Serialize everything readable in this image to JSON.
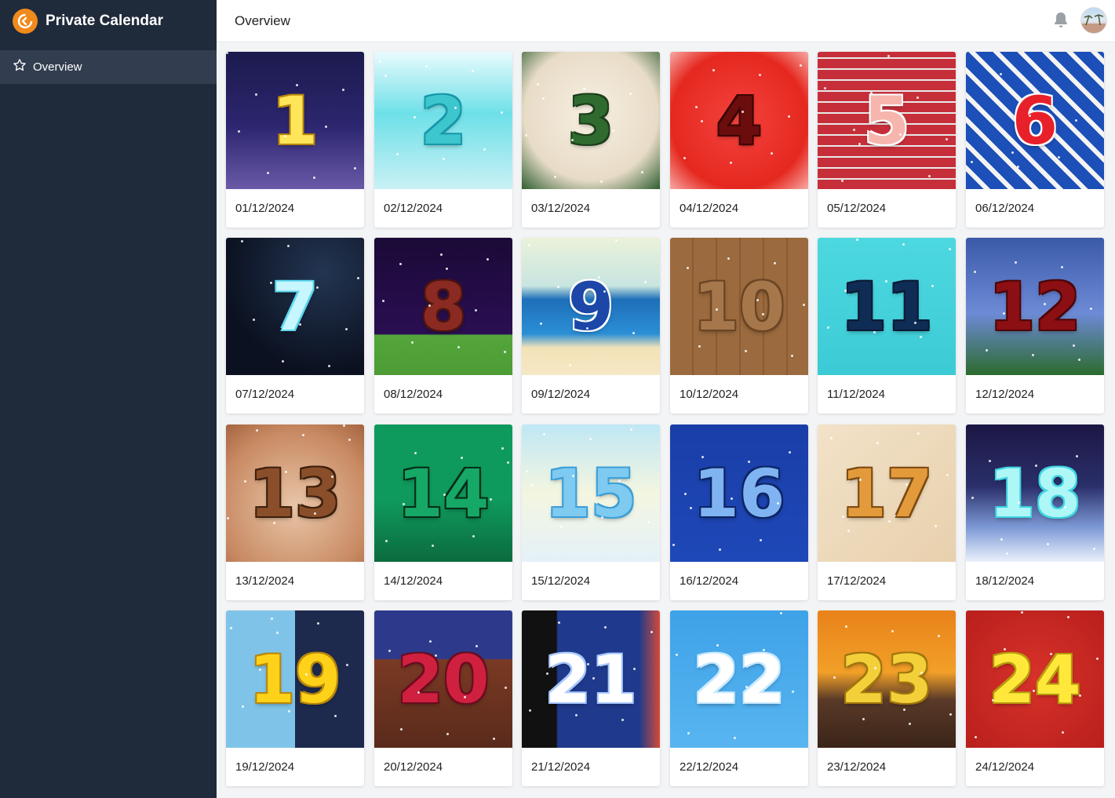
{
  "app": {
    "title": "Private Calendar"
  },
  "sidebar": {
    "items": [
      {
        "label": "Overview",
        "icon": "star-outline-icon"
      }
    ]
  },
  "header": {
    "title": "Overview"
  },
  "cards": [
    {
      "number": "1",
      "date": "01/12/2024",
      "bg": "linear-gradient(180deg,#1b1a4d 0%,#2d2670 55%,#6a5aa8 100%)",
      "color": "#ffe55a",
      "stroke": "#b8860b"
    },
    {
      "number": "2",
      "date": "02/12/2024",
      "bg": "linear-gradient(180deg,#e9fbfd 0%,#6ee0e8 45%,#c9f1f5 100%)",
      "color": "#3ec6cf",
      "stroke": "#1597a8"
    },
    {
      "number": "3",
      "date": "03/12/2024",
      "bg": "radial-gradient(circle at 50% 45%,#f7efe2 0%,#e8dcc7 65%,#2f5e31 100%)",
      "color": "#2f6b2e",
      "stroke": "#1c3f1b"
    },
    {
      "number": "4",
      "date": "04/12/2024",
      "bg": "radial-gradient(circle at 50% 50%,#f4433e 0%,#e5281f 70%,#f7a9a4 100%)",
      "color": "#6b0d0d",
      "stroke": "#3d0505"
    },
    {
      "number": "5",
      "date": "05/12/2024",
      "bg": "repeating-linear-gradient(0deg,#c62f3a 0px,#c62f3a 12px,#e9e9e9 12px,#e9e9e9 14px)",
      "color": "#f6b6ae",
      "stroke": "#ffffff"
    },
    {
      "number": "6",
      "date": "06/12/2024",
      "bg": "repeating-linear-gradient(45deg,#1c4fb8 0px,#1c4fb8 16px,#f4f4f4 16px,#f4f4f4 22px)",
      "color": "#e8202a",
      "stroke": "#ffffff"
    },
    {
      "number": "7",
      "date": "07/12/2024",
      "bg": "radial-gradient(circle at 70% 25%,#233552 0%,#0b1120 70%)",
      "color": "#c7f6ff",
      "stroke": "#5fd7f0"
    },
    {
      "number": "8",
      "date": "08/12/2024",
      "bg": "linear-gradient(180deg,#1b0a37 0%,#2a0e52 70%,#54a53c 71%,#4d9c35 100%)",
      "color": "#8a2a22",
      "stroke": "#4c1410"
    },
    {
      "number": "9",
      "date": "09/12/2024",
      "bg": "linear-gradient(180deg,#eaf2d9 0%,#c8e5e0 35%,#1d6fb8 45%,#2b8fd6 70%,#f2e2b7 80%,#f5e8c4 100%)",
      "color": "#1c46a8",
      "stroke": "#ffffff"
    },
    {
      "number": "10",
      "date": "10/12/2024",
      "bg": "repeating-linear-gradient(90deg,#9b6a3e 0px,#9b6a3e 28px,#8a5c33 28px,#8a5c33 30px)",
      "color": "#a6774b",
      "stroke": "#6b4423"
    },
    {
      "number": "11",
      "date": "11/12/2024",
      "bg": "linear-gradient(180deg,#4dd8e0 0%,#3ccbd6 100%)",
      "color": "#0f2c55",
      "stroke": "#0a1a33"
    },
    {
      "number": "12",
      "date": "12/12/2024",
      "bg": "linear-gradient(180deg,#3a5aa8 0%,#6d8ad6 55%,#2c6b2e 100%)",
      "color": "#8c0f14",
      "stroke": "#4c0608"
    },
    {
      "number": "13",
      "date": "13/12/2024",
      "bg": "radial-gradient(circle at 50% 60%,#e9c6a8 0%,#c88a63 70%,#a46440 100%)",
      "color": "#8a4f2a",
      "stroke": "#3c1f0d"
    },
    {
      "number": "14",
      "date": "14/12/2024",
      "bg": "linear-gradient(180deg,#0f9a5d 0%,#0f9a5d 55%,#0b6b3f 100%)",
      "color": "#16a866",
      "stroke": "#062d1a"
    },
    {
      "number": "15",
      "date": "15/12/2024",
      "bg": "linear-gradient(180deg,#bfe7f5 0%,#f3f6e0 50%,#e4f1f8 100%)",
      "color": "#7fcaf0",
      "stroke": "#3b9fd8"
    },
    {
      "number": "16",
      "date": "16/12/2024",
      "bg": "linear-gradient(180deg,#1a3ea8 0%,#1e48b8 100%)",
      "color": "#7fb3f2",
      "stroke": "#0d2563"
    },
    {
      "number": "17",
      "date": "17/12/2024",
      "bg": "linear-gradient(135deg,#f2e2c8 0%,#e8d0ad 100%)",
      "color": "#e39a3a",
      "stroke": "#7a4a12"
    },
    {
      "number": "18",
      "date": "18/12/2024",
      "bg": "linear-gradient(180deg,#1c1744 0%,#2a2f6a 45%,#7d9ad6 75%,#eaf1fb 100%)",
      "color": "#aef7f7",
      "stroke": "#3fd4e0"
    },
    {
      "number": "19",
      "date": "19/12/2024",
      "bg": "linear-gradient(90deg,#7fc4e8 0%,#7fc4e8 50%,#1d2a4d 50%,#1d2a4d 100%)",
      "color": "#ffd21a",
      "stroke": "#b8860b"
    },
    {
      "number": "20",
      "date": "20/12/2024",
      "bg": "linear-gradient(180deg,#2d3a8c 0%,#2d3a8c 35%,#7a3a24 36%,#5a2a1b 100%)",
      "color": "#d02040",
      "stroke": "#6a0d1f"
    },
    {
      "number": "21",
      "date": "21/12/2024",
      "bg": "linear-gradient(90deg,#111 0%,#111 25%,#1f3a8c 26%,#1f3a8c 85%,#d44a3a 100%)",
      "color": "#ffffff",
      "stroke": "#a8c8ff"
    },
    {
      "number": "22",
      "date": "22/12/2024",
      "bg": "linear-gradient(180deg,#3ea2e8 0%,#58b5f0 100%)",
      "color": "#ffffff",
      "stroke": "#c9e9ff"
    },
    {
      "number": "23",
      "date": "23/12/2024",
      "bg": "linear-gradient(180deg,#e8821a 0%,#f2a028 45%,#5a3a28 65%,#3a2418 100%)",
      "color": "#f3d03a",
      "stroke": "#a0760d"
    },
    {
      "number": "24",
      "date": "24/12/2024",
      "bg": "radial-gradient(circle at 50% 50%,#d8322a 0%,#b81f1c 100%)",
      "color": "#ffe83a",
      "stroke": "#b89a0d"
    }
  ]
}
